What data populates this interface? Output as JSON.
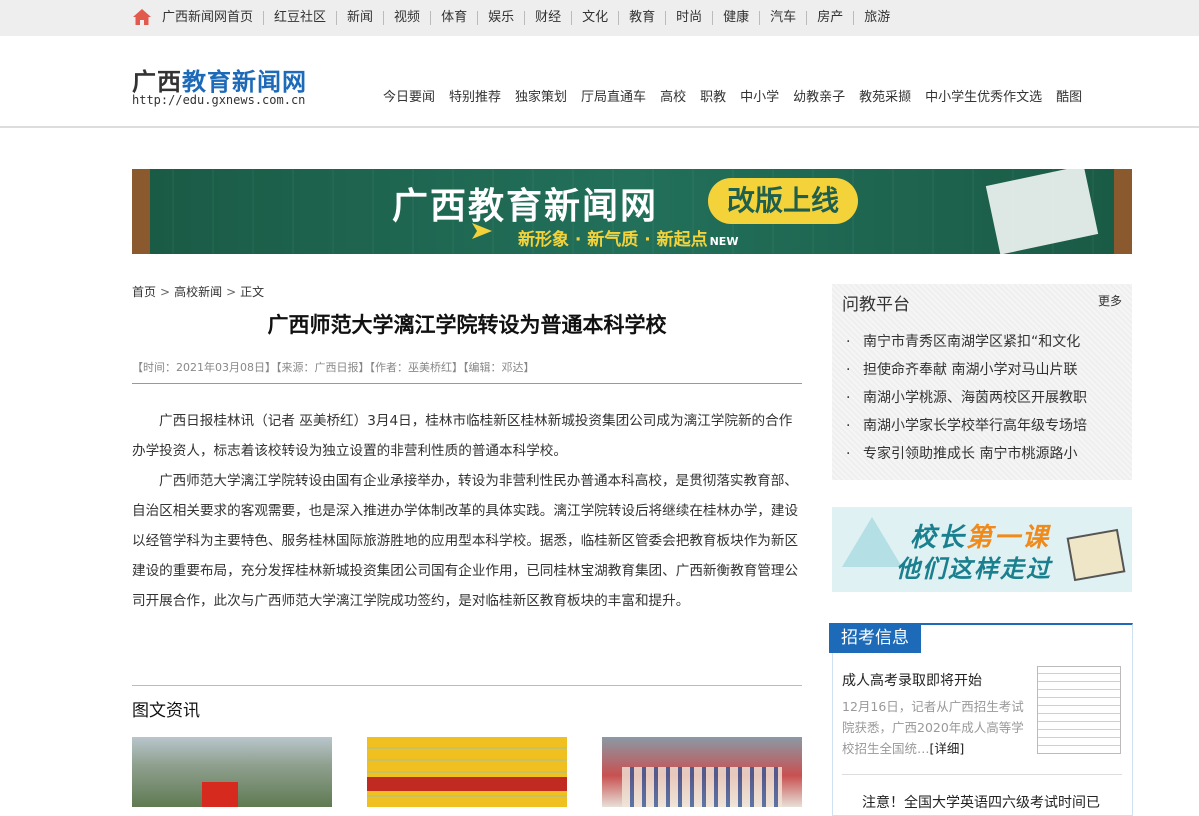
{
  "topbar": {
    "home_icon": "home-icon",
    "links": [
      "广西新闻网首页",
      "红豆社区",
      "新闻",
      "视频",
      "体育",
      "娱乐",
      "财经",
      "文化",
      "教育",
      "时尚",
      "健康",
      "汽车",
      "房产",
      "旅游"
    ]
  },
  "header": {
    "logo_part1": "广西",
    "logo_part2": "教育新闻网",
    "logo_url": "http://edu.gxnews.com.cn",
    "nav": [
      "今日要闻",
      "特别推荐",
      "独家策划",
      "厅局直通车",
      "高校",
      "职教",
      "中小学",
      "幼教亲子",
      "教苑采撷",
      "中小学生优秀作文选",
      "酷图"
    ]
  },
  "banner": {
    "title": "广西教育新闻网",
    "pill": "改版上线",
    "subtitle": "新形象 · 新气质 · 新起点",
    "new_tag": "NEW"
  },
  "breadcrumb": [
    "首页",
    "高校新闻",
    "正文"
  ],
  "article": {
    "title": "广西师范大学漓江学院转设为普通本科学校",
    "meta": "【时间：2021年03月08日】【来源：广西日报】【作者：巫美桥红】【编辑：邓达】",
    "paragraphs": [
      "广西日报桂林讯（记者 巫美桥红）3月4日，桂林市临桂新区桂林新城投资集团公司成为漓江学院新的合作办学投资人，标志着该校转设为独立设置的非营利性质的普通本科学校。",
      "广西师范大学漓江学院转设由国有企业承接举办，转设为非营利性民办普通本科高校，是贯彻落实教育部、自治区相关要求的客观需要，也是深入推进办学体制改革的具体实践。漓江学院转设后将继续在桂林办学，建设以经管学科为主要特色、服务桂林国际旅游胜地的应用型本科学校。据悉，临桂新区管委会把教育板块作为新区建设的重要布局，充分发挥桂林新城投资集团公司国有企业作用，已同桂林宝湖教育集团、广西新衡教育管理公司开展合作，此次与广西师范大学漓江学院成功签约，是对临桂新区教育板块的丰富和提升。"
    ]
  },
  "picture_news": {
    "title": "图文资讯"
  },
  "sidebar": {
    "qa": {
      "title": "问教平台",
      "more": "更多",
      "items": [
        "南宁市青秀区南湖学区紧扣“和文化",
        "担使命齐奉献 南湖小学对马山片联",
        "南湖小学桃源、海茵两校区开展教职",
        "南湖小学家长学校举行高年级专场培",
        "专家引领助推成长 南宁市桃源路小"
      ]
    },
    "promo": {
      "line1_a": "校长",
      "line1_b": "第一课",
      "line2": "他们这样走过"
    },
    "recruit": {
      "tab": "招考信息",
      "headline": "成人高考录取即将开始",
      "summary": "12月16日，记者从广西招生考试院获悉，广西2020年成人高等学校招生全国统…",
      "detail_link": "[详细]",
      "next_headline": "注意！全国大学英语四六级考试时间已"
    }
  },
  "colors": {
    "brand_blue": "#1d6bb8",
    "banner_green": "#1e5f4e",
    "banner_yellow": "#f4d23a",
    "promo_orange": "#f08a1a"
  }
}
